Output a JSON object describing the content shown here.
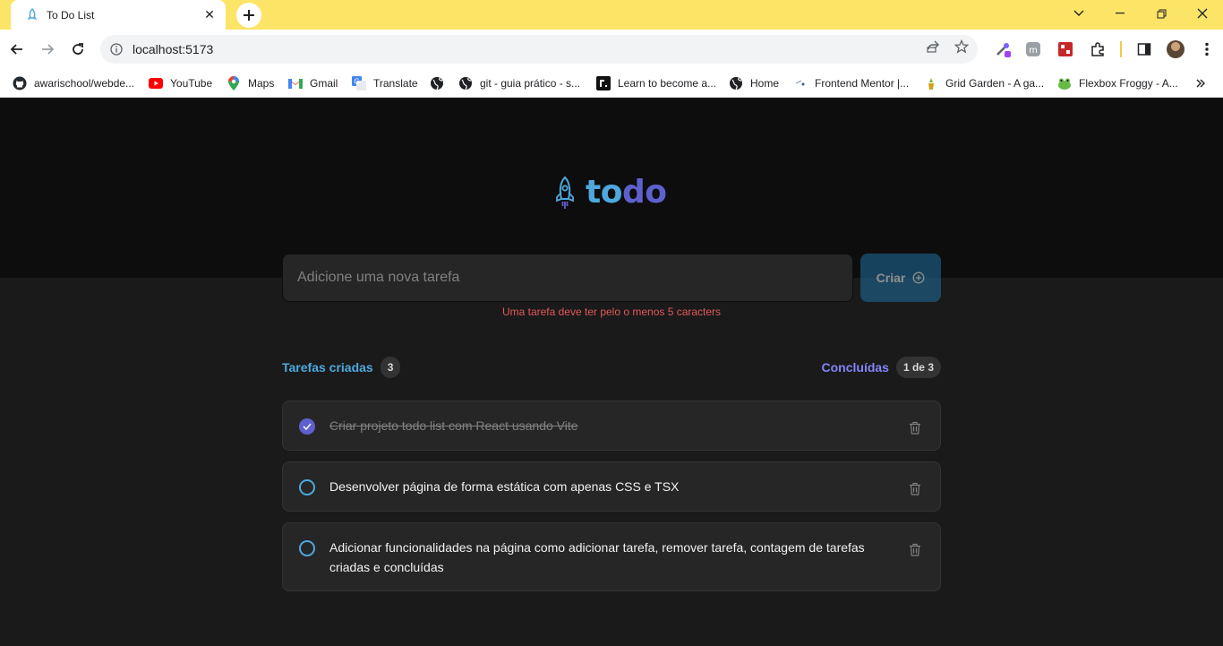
{
  "browser": {
    "tab_title": "To Do List",
    "url": "localhost:5173",
    "bookmarks": [
      {
        "label": "awarischool/webde...",
        "icon": "github-icon"
      },
      {
        "label": "YouTube",
        "icon": "youtube-icon"
      },
      {
        "label": "Maps",
        "icon": "maps-icon"
      },
      {
        "label": "Gmail",
        "icon": "gmail-icon"
      },
      {
        "label": "Translate",
        "icon": "translate-icon"
      },
      {
        "label": "",
        "icon": "globe-icon"
      },
      {
        "label": "git - guia prático - s...",
        "icon": "globe-icon"
      },
      {
        "label": "Learn to become a...",
        "icon": "roadmap-icon"
      },
      {
        "label": "Home",
        "icon": "globe-icon"
      },
      {
        "label": "Frontend Mentor |...",
        "icon": "frontend-mentor-icon"
      },
      {
        "label": "Grid Garden - A ga...",
        "icon": "grid-garden-icon"
      },
      {
        "label": "Flexbox Froggy - A...",
        "icon": "flexbox-froggy-icon"
      }
    ]
  },
  "app": {
    "logo_to": "to",
    "logo_do": "do",
    "input_placeholder": "Adicione uma nova tarefa",
    "input_value": "",
    "create_label": "Criar",
    "error": "Uma tarefa deve ter pelo o menos 5 caracters",
    "created_label": "Tarefas criadas",
    "created_count": "3",
    "done_label": "Concluídas",
    "done_count": "1 de 3",
    "tasks": [
      {
        "text": "Criar projeto todo list com React usando Vite",
        "done": true
      },
      {
        "text": "Desenvolver página de forma estática com apenas CSS e TSX",
        "done": false
      },
      {
        "text": "Adicionar funcionalidades na página como adicionar tarefa, remover tarefa, contagem de tarefas criadas e concluídas",
        "done": false
      }
    ]
  },
  "colors": {
    "blue": "#4ea8de",
    "purple": "#5e60ce",
    "purple_light": "#8284fa",
    "danger": "#e25858",
    "tab_strip": "#fce466"
  }
}
